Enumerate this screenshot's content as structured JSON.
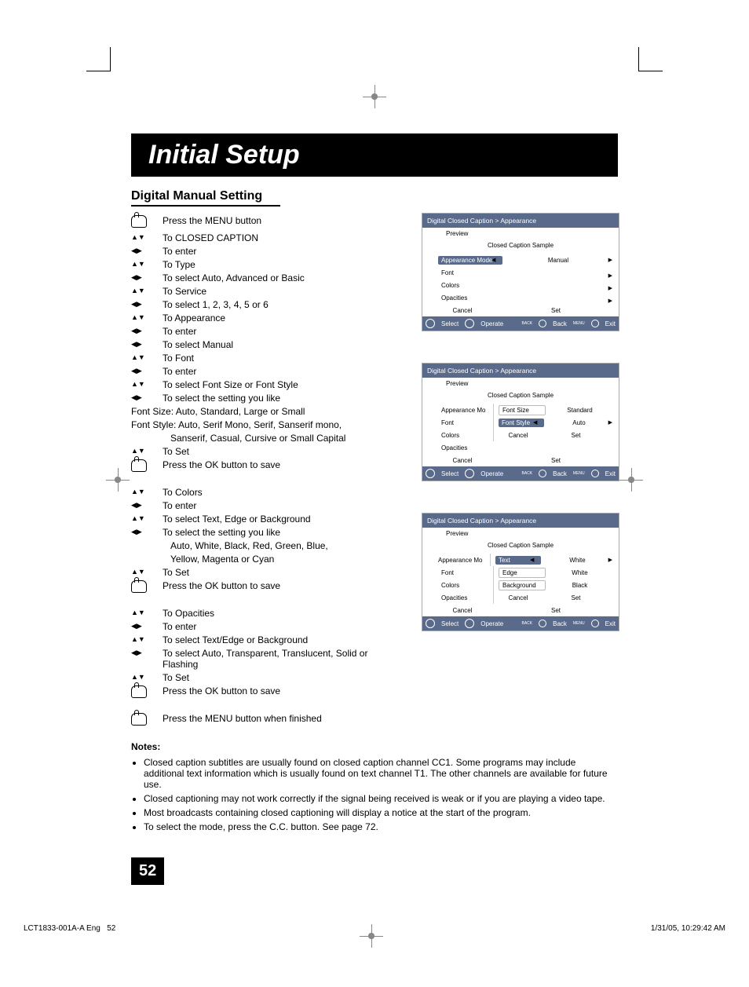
{
  "title": "Initial Setup",
  "section": "Digital Manual Setting",
  "steps": [
    {
      "icon": "hand",
      "text": "Press the MENU button"
    },
    {
      "icon": "ud",
      "text": "To CLOSED CAPTION"
    },
    {
      "icon": "lr",
      "text": "To enter"
    },
    {
      "icon": "ud",
      "text": "To Type"
    },
    {
      "icon": "lr",
      "text": "To select Auto, Advanced or Basic"
    },
    {
      "icon": "ud",
      "text": "To Service"
    },
    {
      "icon": "lr",
      "text": "To select 1, 2, 3, 4, 5 or 6"
    },
    {
      "icon": "ud",
      "text": "To Appearance"
    },
    {
      "icon": "lr",
      "text": "To enter"
    },
    {
      "icon": "lr",
      "text": "To select Manual"
    },
    {
      "icon": "ud",
      "text": "To Font"
    },
    {
      "icon": "lr",
      "text": "To enter"
    },
    {
      "icon": "ud",
      "text": "To select Font Size or Font Style"
    },
    {
      "icon": "lr",
      "text": "To select the setting you like"
    }
  ],
  "font_note1": "Font Size: Auto, Standard, Large or Small",
  "font_note2": "Font Style: Auto, Serif Mono, Serif, Sanserif mono,",
  "font_note3": "Sanserif, Casual, Cursive or Small Capital",
  "steps2": [
    {
      "icon": "ud",
      "text": "To Set"
    },
    {
      "icon": "hand",
      "text": "Press the OK button to save"
    }
  ],
  "steps3": [
    {
      "icon": "ud",
      "text": "To Colors"
    },
    {
      "icon": "lr",
      "text": "To enter"
    },
    {
      "icon": "ud",
      "text": "To select Text, Edge or Background"
    },
    {
      "icon": "lr",
      "text": "To select the setting you like"
    }
  ],
  "color_note1": "Auto, White, Black, Red, Green, Blue,",
  "color_note2": "Yellow, Magenta or Cyan",
  "steps4": [
    {
      "icon": "ud",
      "text": "To Set"
    },
    {
      "icon": "hand",
      "text": "Press the OK button to save"
    }
  ],
  "steps5": [
    {
      "icon": "ud",
      "text": "To Opacities"
    },
    {
      "icon": "lr",
      "text": "To enter"
    },
    {
      "icon": "ud",
      "text": "To select Text/Edge or Background"
    },
    {
      "icon": "lr",
      "text": "To select Auto, Transparent, Translucent, Solid or Flashing"
    },
    {
      "icon": "ud",
      "text": "To Set"
    },
    {
      "icon": "hand",
      "text": "Press the OK button to save"
    }
  ],
  "final": {
    "icon": "hand",
    "text": "Press the MENU button when finished"
  },
  "osd": {
    "breadcrumb": "Digital Closed Caption  >  Appearance",
    "preview": "Preview",
    "sample": "Closed Caption Sample",
    "rows1": {
      "r1_label": "Appearance Mode",
      "r1_val": "Manual",
      "r2_label": "Font",
      "r3_label": "Colors",
      "r4_label": "Opacities"
    },
    "cancel": "Cancel",
    "set": "Set",
    "footer": {
      "select": "Select",
      "operate": "Operate",
      "back": "Back",
      "exit": "Exit",
      "backLabel": "BACK",
      "menuLabel": "MENU"
    },
    "screen2": {
      "l1": "Appearance Mo",
      "m1": "Font Size",
      "v1": "Standard",
      "l2": "Font",
      "m2": "Font Style",
      "v2": "Auto",
      "l3": "Colors",
      "m3": "Cancel",
      "v3": "Set",
      "l4": "Opacities"
    },
    "screen3": {
      "l1": "Appearance Mo",
      "m1": "Text",
      "v1": "White",
      "l2": "Font",
      "m2": "Edge",
      "v2": "White",
      "l3": "Colors",
      "m3": "Background",
      "v3": "Black",
      "l4": "Opacities",
      "m4": "Cancel",
      "v4": "Set"
    }
  },
  "notes_heading": "Notes:",
  "notes": [
    "Closed caption subtitles are usually found on closed caption channel CC1. Some programs may include additional text information which is usually found on text channel T1. The other channels are available for future use.",
    "Closed captioning may not work correctly if the signal being received is weak or if you are playing a video tape.",
    "Most broadcasts containing closed captioning will display a notice at the start of the program.",
    "To select the mode, press the C.C. button. See page 72."
  ],
  "page_number": "52",
  "footer_left": "LCT1833-001A-A Eng",
  "footer_left_page": "52",
  "footer_right": "1/31/05, 10:29:42 AM"
}
